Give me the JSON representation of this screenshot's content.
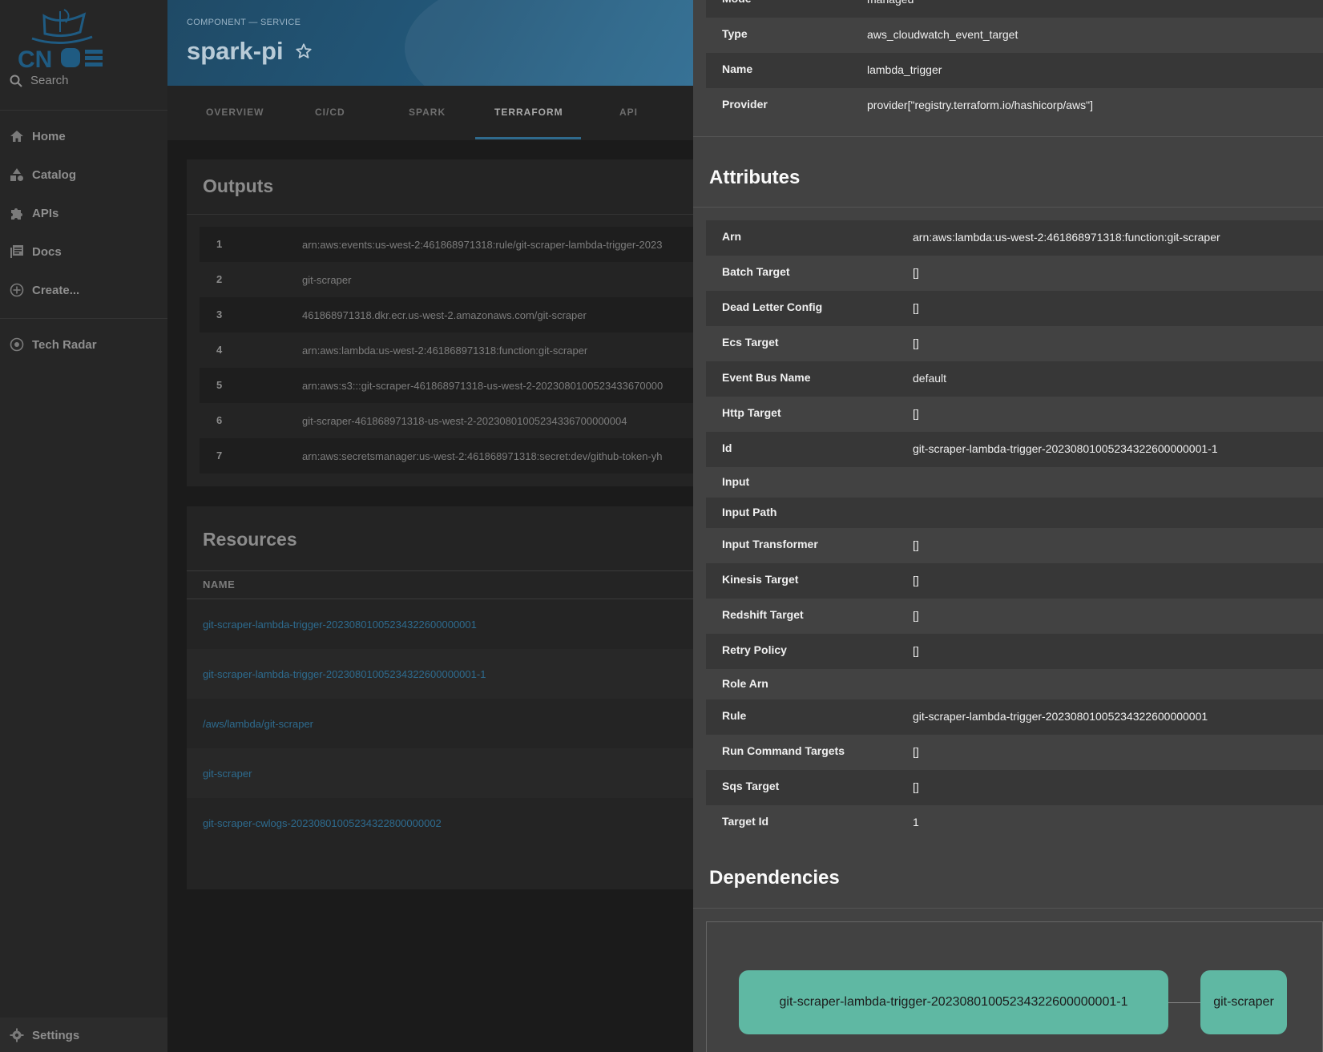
{
  "sidebar": {
    "search_label": "Search",
    "items": [
      {
        "label": "Home",
        "icon": "home-icon"
      },
      {
        "label": "Catalog",
        "icon": "catalog-icon"
      },
      {
        "label": "APIs",
        "icon": "puzzle-icon"
      },
      {
        "label": "Docs",
        "icon": "docs-icon"
      },
      {
        "label": "Create...",
        "icon": "plus-circle-icon"
      },
      {
        "label": "Tech Radar",
        "icon": "radar-icon"
      }
    ],
    "settings_label": "Settings"
  },
  "header": {
    "breadcrumb": "COMPONENT — SERVICE",
    "title": "spark-pi"
  },
  "tabs": [
    {
      "label": "OVERVIEW"
    },
    {
      "label": "CI/CD"
    },
    {
      "label": "SPARK"
    },
    {
      "label": "TERRAFORM",
      "active": true
    },
    {
      "label": "API"
    }
  ],
  "outputs": {
    "title": "Outputs",
    "rows": [
      {
        "num": "1",
        "value": "arn:aws:events:us-west-2:461868971318:rule/git-scraper-lambda-trigger-2023"
      },
      {
        "num": "2",
        "value": "git-scraper"
      },
      {
        "num": "3",
        "value": "461868971318.dkr.ecr.us-west-2.amazonaws.com/git-scraper"
      },
      {
        "num": "4",
        "value": "arn:aws:lambda:us-west-2:461868971318:function:git-scraper"
      },
      {
        "num": "5",
        "value": "arn:aws:s3:::git-scraper-461868971318-us-west-2-2023080100523433670000"
      },
      {
        "num": "6",
        "value": "git-scraper-461868971318-us-west-2-20230801005234336700000004"
      },
      {
        "num": "7",
        "value": "arn:aws:secretsmanager:us-west-2:461868971318:secret:dev/github-token-yh"
      }
    ]
  },
  "resources": {
    "title": "Resources",
    "column_name": "NAME",
    "rows": [
      "git-scraper-lambda-trigger-20230801005234322600000001",
      "git-scraper-lambda-trigger-20230801005234322600000001-1",
      "/aws/lambda/git-scraper",
      "git-scraper",
      "git-scraper-cwlogs-20230801005234322800000002"
    ]
  },
  "drawer": {
    "top_rows": [
      {
        "key": "Mode",
        "value": "managed"
      },
      {
        "key": "Type",
        "value": "aws_cloudwatch_event_target"
      },
      {
        "key": "Name",
        "value": "lambda_trigger"
      },
      {
        "key": "Provider",
        "value": "provider[\"registry.terraform.io/hashicorp/aws\"]"
      }
    ],
    "attributes_title": "Attributes",
    "attributes": [
      {
        "key": "Arn",
        "value": "arn:aws:lambda:us-west-2:461868971318:function:git-scraper"
      },
      {
        "key": "Batch Target",
        "value": "[]"
      },
      {
        "key": "Dead Letter Config",
        "value": "[]"
      },
      {
        "key": "Ecs Target",
        "value": "[]"
      },
      {
        "key": "Event Bus Name",
        "value": "default"
      },
      {
        "key": "Http Target",
        "value": "[]"
      },
      {
        "key": "Id",
        "value": "git-scraper-lambda-trigger-20230801005234322600000001-1"
      },
      {
        "key": "Input",
        "value": ""
      },
      {
        "key": "Input Path",
        "value": ""
      },
      {
        "key": "Input Transformer",
        "value": "[]"
      },
      {
        "key": "Kinesis Target",
        "value": "[]"
      },
      {
        "key": "Redshift Target",
        "value": "[]"
      },
      {
        "key": "Retry Policy",
        "value": "[]"
      },
      {
        "key": "Role Arn",
        "value": ""
      },
      {
        "key": "Rule",
        "value": "git-scraper-lambda-trigger-20230801005234322600000001"
      },
      {
        "key": "Run Command Targets",
        "value": "[]"
      },
      {
        "key": "Sqs Target",
        "value": "[]"
      },
      {
        "key": "Target Id",
        "value": "1"
      }
    ],
    "dependencies_title": "Dependencies",
    "dependencies": [
      {
        "label": "git-scraper-lambda-trigger-20230801005234322600000001-1"
      },
      {
        "label": "git-scraper"
      }
    ]
  },
  "colors": {
    "accent": "#2f6a8d",
    "node": "#5fb8a3"
  }
}
